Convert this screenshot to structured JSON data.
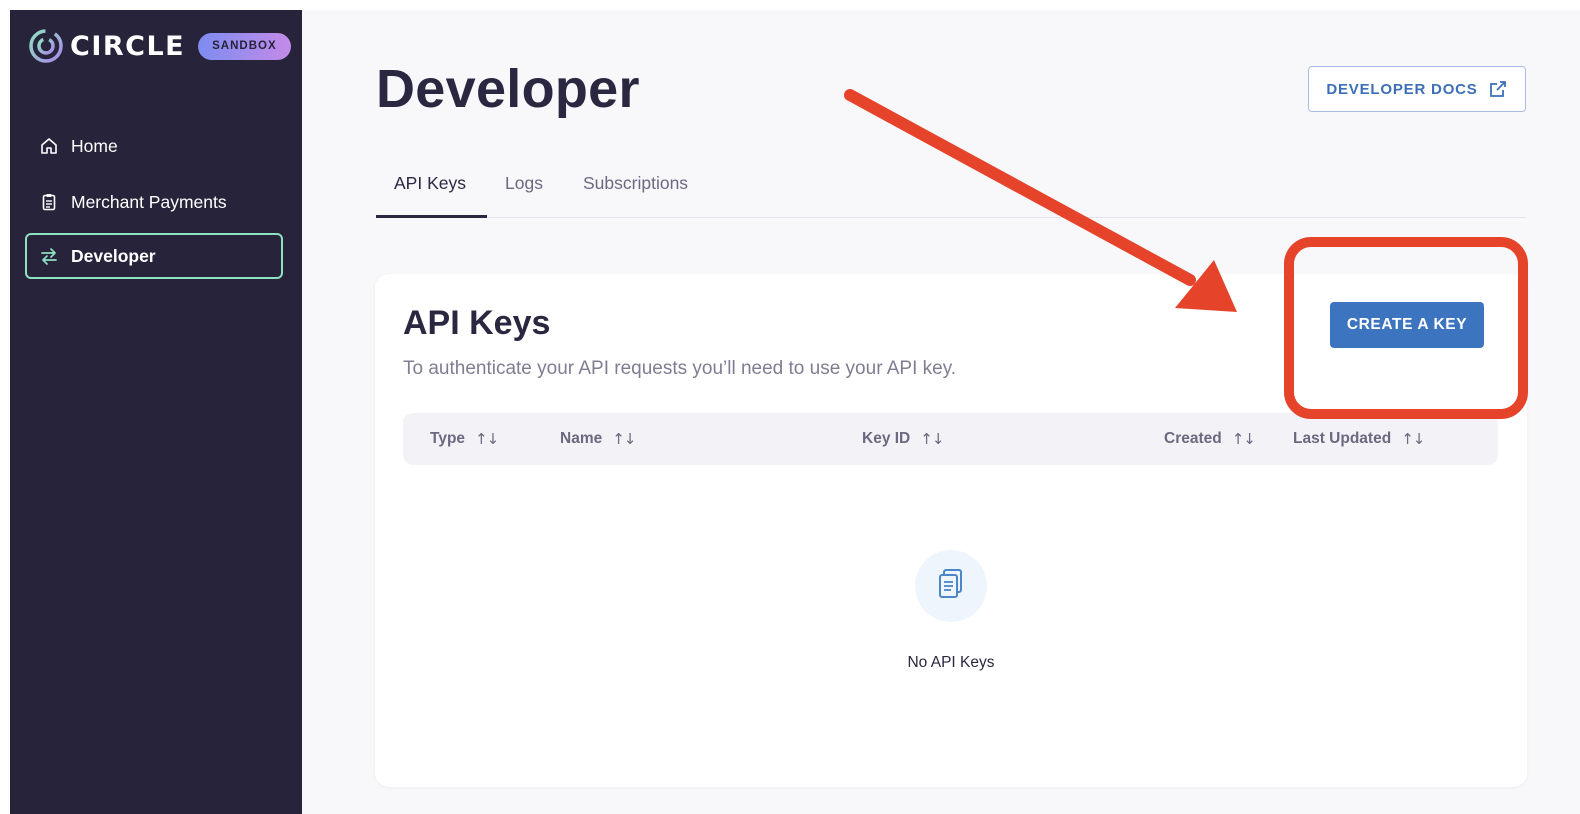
{
  "brand": {
    "logo_text": "CIRCLE",
    "badge": "SANDBOX",
    "colors": {
      "sidebar_bg": "#27233a",
      "accent_blue": "#3d74bf",
      "active_border": "#8fe1c2",
      "annotation_red": "#e5432a"
    }
  },
  "sidebar": {
    "items": [
      {
        "label": "Home",
        "icon": "home-icon"
      },
      {
        "label": "Merchant Payments",
        "icon": "clipboard-icon"
      },
      {
        "label": "Developer",
        "icon": "arrows-exchange-icon",
        "active": true
      }
    ]
  },
  "header": {
    "title": "Developer",
    "docs_button": "DEVELOPER DOCS"
  },
  "tabs": [
    {
      "label": "API Keys",
      "active": true
    },
    {
      "label": "Logs"
    },
    {
      "label": "Subscriptions"
    }
  ],
  "api_keys": {
    "title": "API Keys",
    "description": "To authenticate your API requests you’ll need to use your API key.",
    "create_button": "CREATE A KEY",
    "columns": [
      "Type",
      "Name",
      "Key ID",
      "Created",
      "Last Updated"
    ],
    "sort_glyph": "↑↓",
    "empty_icon": "documents-icon",
    "empty_text": "No API Keys"
  }
}
